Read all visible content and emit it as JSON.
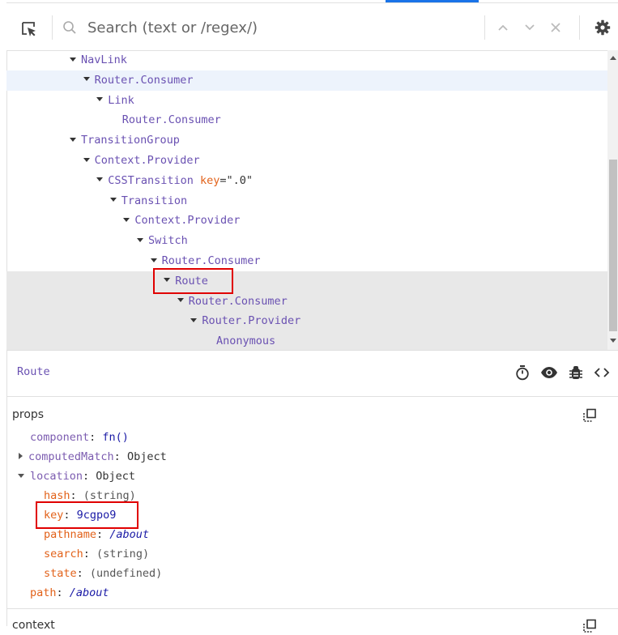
{
  "search": {
    "placeholder": "Search (text or /regex/)"
  },
  "tree": [
    {
      "indent": 0,
      "label": "NavLink",
      "expanded": true,
      "state": ""
    },
    {
      "indent": 1,
      "label": "Router.Consumer",
      "expanded": true,
      "state": "hover"
    },
    {
      "indent": 2,
      "label": "Link",
      "expanded": true,
      "state": ""
    },
    {
      "indent": 3,
      "label": "Router.Consumer",
      "expanded": false,
      "state": ""
    },
    {
      "indent": 0,
      "label": "TransitionGroup",
      "expanded": true,
      "state": ""
    },
    {
      "indent": 1,
      "label": "Context.Provider",
      "expanded": true,
      "state": ""
    },
    {
      "indent": 2,
      "label": "CSSTransition",
      "expanded": true,
      "state": "",
      "attr_name": "key",
      "attr_value": "\".0\""
    },
    {
      "indent": 3,
      "label": "Transition",
      "expanded": true,
      "state": ""
    },
    {
      "indent": 4,
      "label": "Context.Provider",
      "expanded": true,
      "state": ""
    },
    {
      "indent": 5,
      "label": "Switch",
      "expanded": true,
      "state": ""
    },
    {
      "indent": 6,
      "label": "Router.Consumer",
      "expanded": true,
      "state": ""
    },
    {
      "indent": 7,
      "label": "Route",
      "expanded": true,
      "state": "selected"
    },
    {
      "indent": 8,
      "label": "Router.Consumer",
      "expanded": true,
      "state": "selected-bg"
    },
    {
      "indent": 9,
      "label": "Router.Provider",
      "expanded": true,
      "state": "selected-bg"
    },
    {
      "indent": 10,
      "label": "Anonymous",
      "expanded": false,
      "state": "selected-bg"
    }
  ],
  "inspector": {
    "selected_name": "Route",
    "props_title": "props",
    "context_title": "context",
    "props": {
      "component_key": "component",
      "component_val": "fn()",
      "computedMatch_key": "computedMatch",
      "computedMatch_val": "Object",
      "location_key": "location",
      "location_val": "Object",
      "hash_key": "hash",
      "hash_val": "(string)",
      "key_key": "key",
      "key_val": "9cgpo9",
      "pathname_key": "pathname",
      "pathname_val": "/about",
      "search_key": "search",
      "search_val": "(string)",
      "state_key": "state",
      "state_val": "(undefined)",
      "path_key": "path",
      "path_val": "/about"
    }
  },
  "colors": {
    "component": "#6a51b2",
    "attr": "#e2621a",
    "accent": "#1a73e8",
    "highlight_box": "#e00000"
  }
}
